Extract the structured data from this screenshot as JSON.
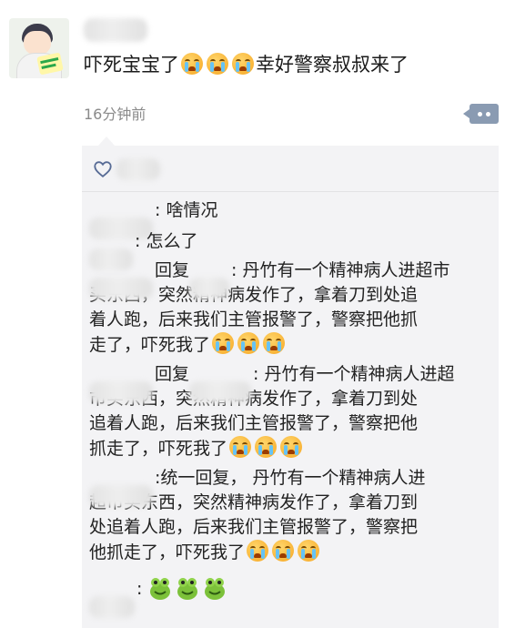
{
  "post": {
    "text": "吓死宝宝了",
    "text_after": "幸好警察叔叔来了",
    "time": "16分钟前"
  },
  "comments": [
    {
      "sep": ":",
      "text": " 啥情况"
    },
    {
      "sep": ":",
      "text": " 怎么了"
    },
    {
      "reply": "回复",
      "sep": ":",
      "lines": [
        "丹竹有一个精神病人进超市",
        "买东西，突然精神病发作了，拿着刀到处追",
        "着人跑，后来我们主管报警了，警察把他抓",
        "走了，吓死我了"
      ]
    },
    {
      "reply": "回复",
      "sep": ":",
      "lines": [
        "丹竹有一个精神病人进超",
        "市买东西，突然精神病发作了，拿着刀到处",
        "追着人跑，后来我们主管报警了，警察把他",
        "抓走了，吓死我了"
      ]
    },
    {
      "sep": ":",
      "lines": [
        "统一回复， 丹竹有一个精神病人进",
        "超市买东西，突然精神病发作了，拿着刀到",
        "处追着人跑，后来我们主管报警了，警察把",
        "他抓走了，吓死我了"
      ]
    },
    {
      "sep": ":"
    }
  ],
  "colors": {
    "link": "#576b95",
    "time": "#8a8a8a",
    "panel": "#f3f3f5"
  },
  "icons": [
    "crying-emoji-icon",
    "heart-outline-icon",
    "more-dots-icon",
    "frog-emoji-icon"
  ]
}
